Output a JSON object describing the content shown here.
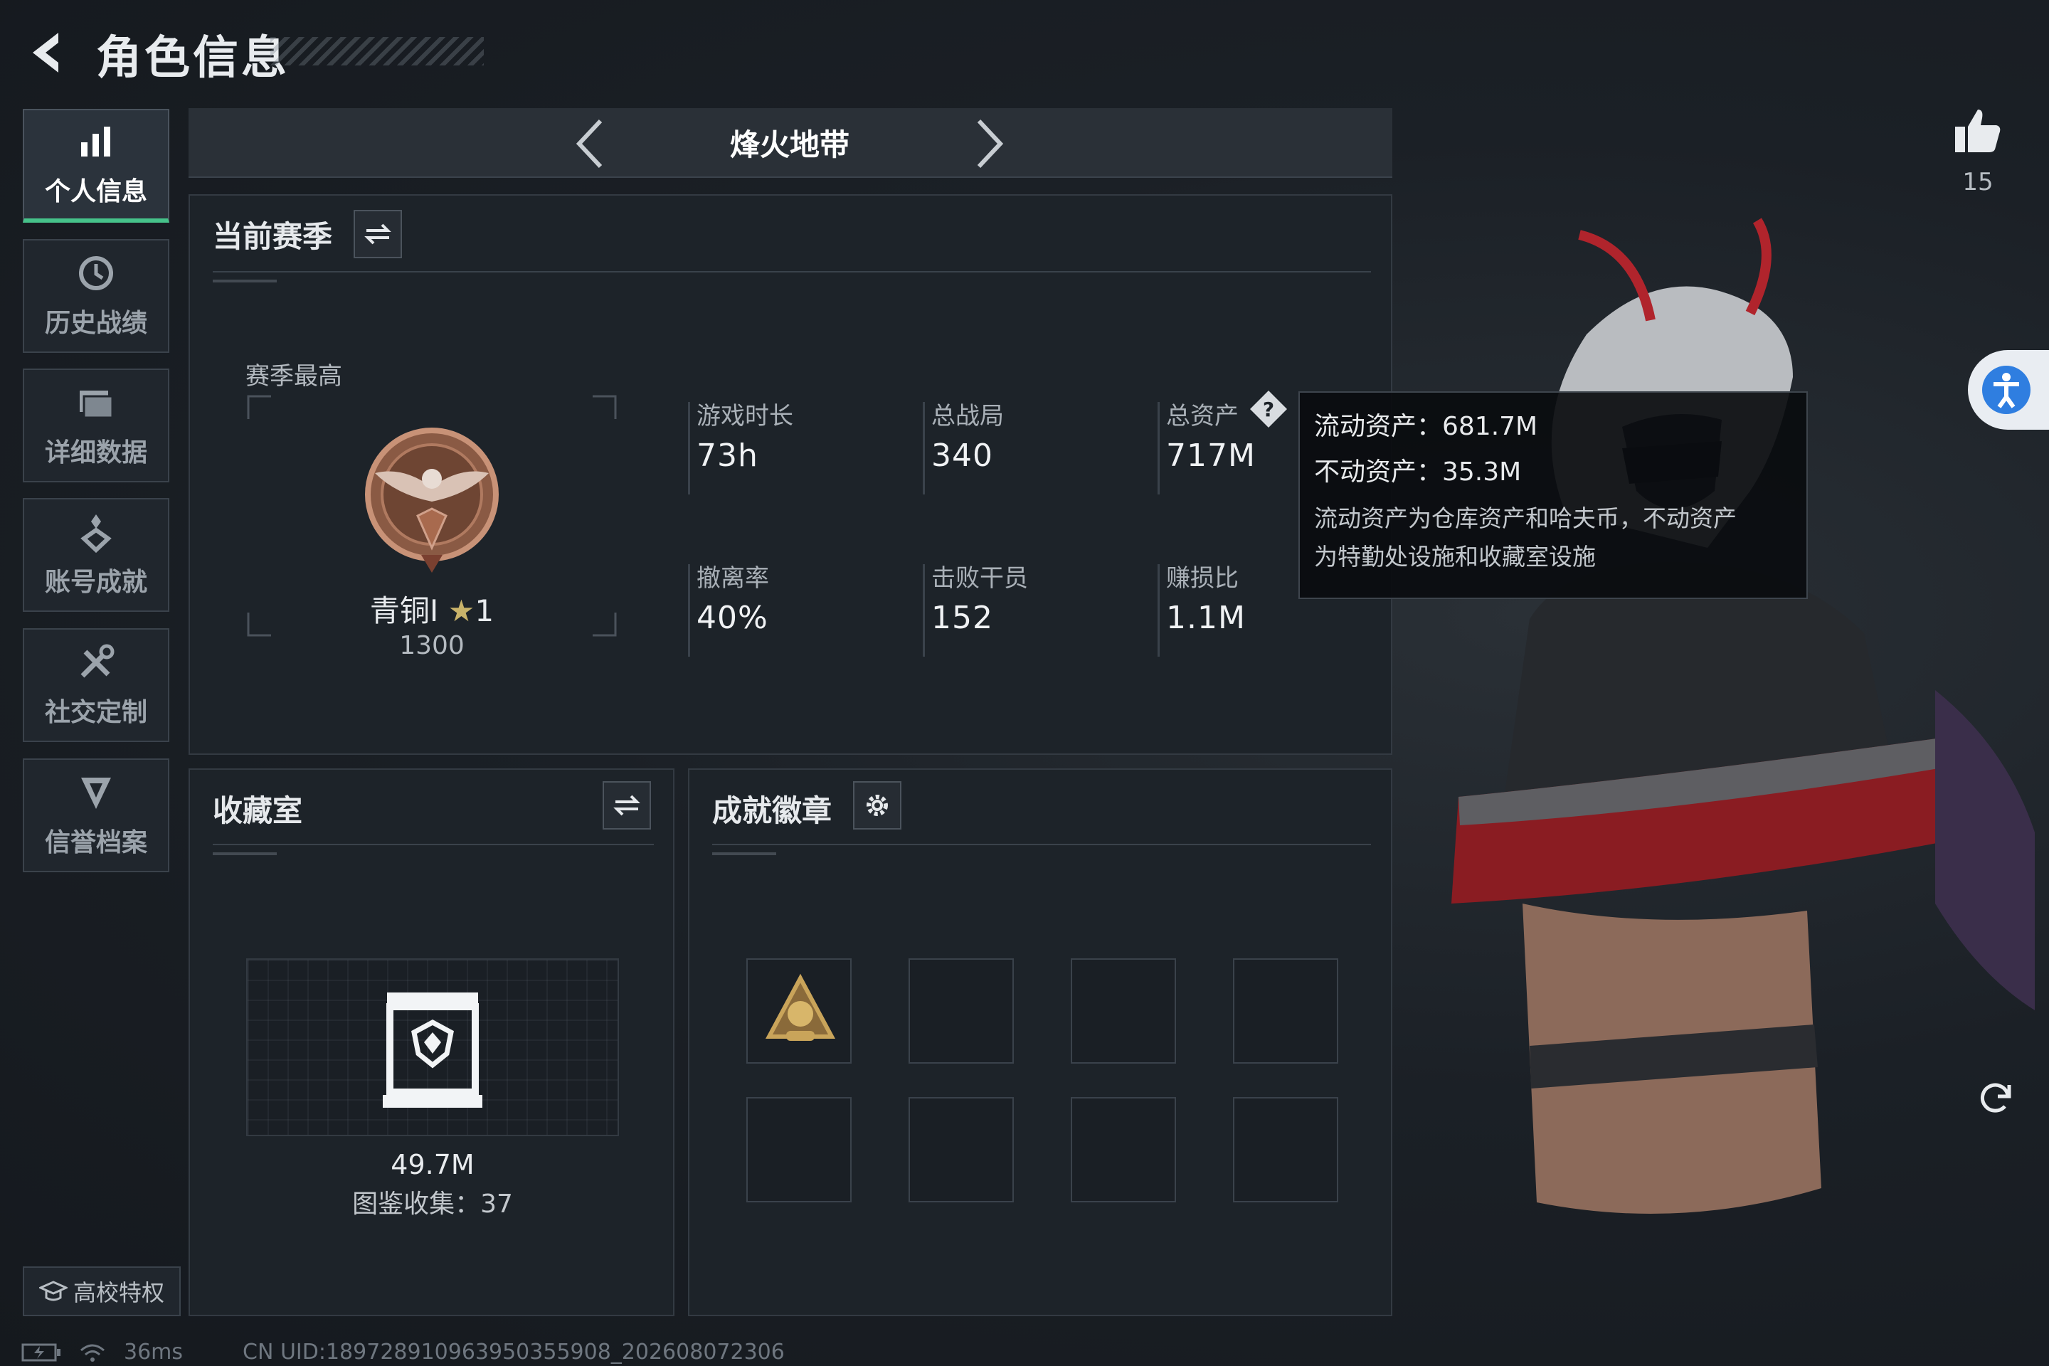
{
  "header": {
    "title": "角色信息"
  },
  "sidebar": {
    "items": [
      {
        "label": "个人信息",
        "icon": "bar-chart-icon",
        "active": true
      },
      {
        "label": "历史战绩",
        "icon": "history-icon",
        "active": false
      },
      {
        "label": "详细数据",
        "icon": "folder-icon",
        "active": false
      },
      {
        "label": "账号成就",
        "icon": "achievement-icon",
        "active": false
      },
      {
        "label": "社交定制",
        "icon": "tools-icon",
        "active": false
      },
      {
        "label": "信誉档案",
        "icon": "shield-icon",
        "active": false
      }
    ],
    "college_perk": "高校特权"
  },
  "mode_bar": {
    "title": "烽火地带"
  },
  "season": {
    "title": "当前赛季",
    "best_label": "赛季最高",
    "rank_name": "青铜I",
    "rank_stars": "1",
    "rank_points": "1300",
    "stats": [
      {
        "label": "游戏时长",
        "value": "73h"
      },
      {
        "label": "总战局",
        "value": "340"
      },
      {
        "label": "总资产",
        "value": "717M"
      },
      {
        "label": "撤离率",
        "value": "40%"
      },
      {
        "label": "击败干员",
        "value": "152"
      },
      {
        "label": "赚损比",
        "value": "1.1M"
      }
    ]
  },
  "tooltip": {
    "liquid": "流动资产：681.7M",
    "fixed": "不动资产：35.3M",
    "note_line1": "流动资产为仓库资产和哈夫币，不动资产",
    "note_line2": "为特勤处设施和收藏室设施"
  },
  "collection": {
    "title": "收藏室",
    "value": "49.7M",
    "collected": "图鉴收集：37"
  },
  "badges": {
    "title": "成就徽章",
    "filled": 1,
    "total": 8
  },
  "likes": {
    "count": "15"
  },
  "status": {
    "ping": "36ms",
    "uid": "CN UID:1897289109639503559​08_202608072306"
  },
  "colors": {
    "accent": "#46c28a",
    "panel": "#1d2329",
    "background": "#1b2026"
  }
}
